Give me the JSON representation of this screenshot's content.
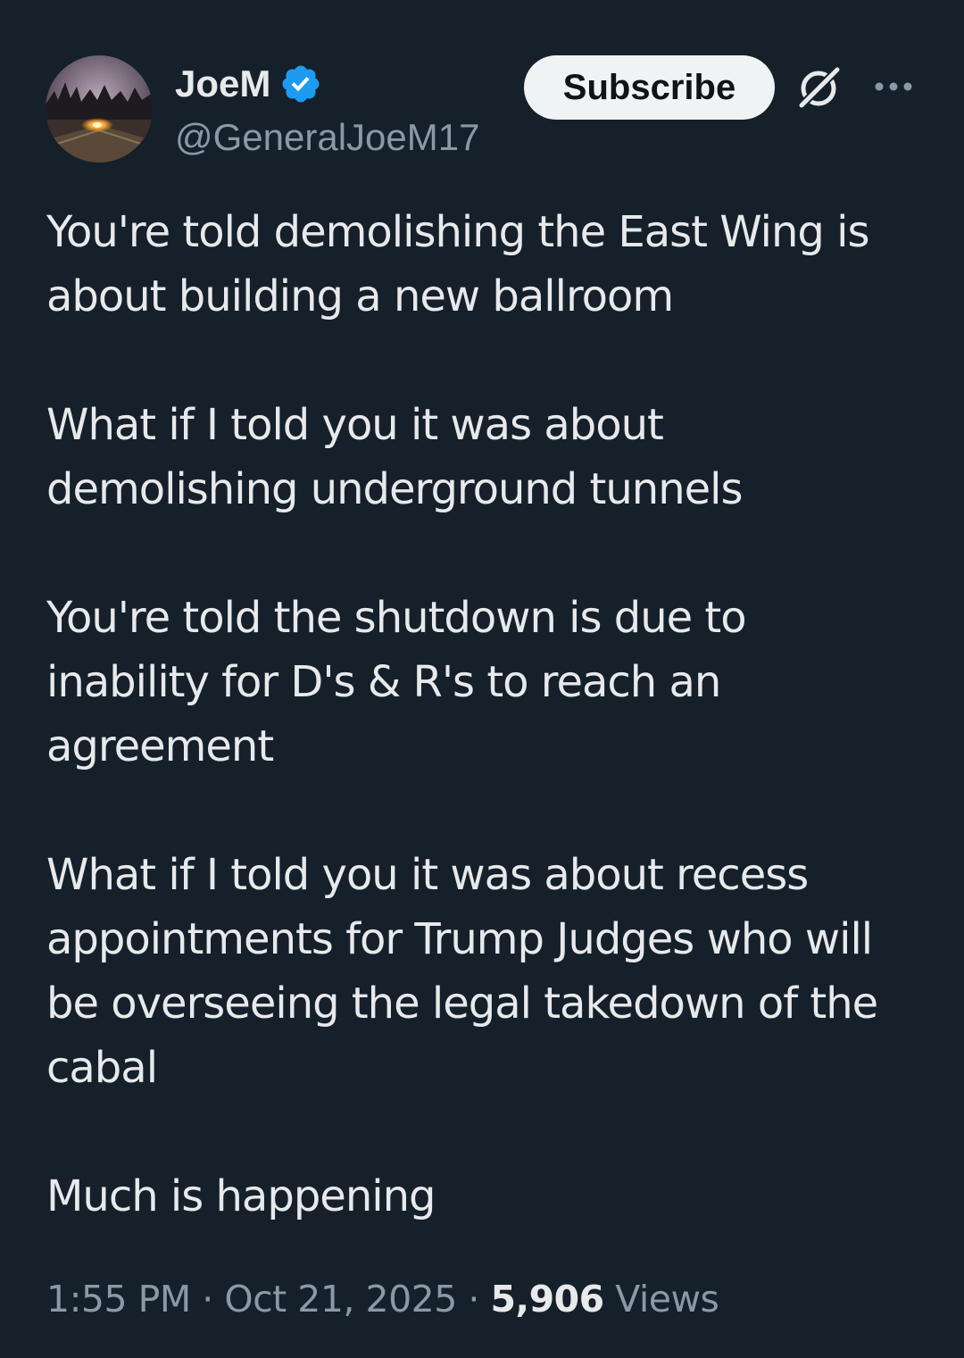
{
  "author": {
    "display_name": "JoeM",
    "handle": "@GeneralJoeM17",
    "verified": true,
    "avatar_icon": "avatar-photo"
  },
  "actions": {
    "subscribe_label": "Subscribe",
    "grok_icon": "grok-icon",
    "more_icon": "more-icon"
  },
  "tweet": {
    "paragraphs": [
      "You're told demolishing the East Wing is about building a new ballroom",
      "What if I told you it was about demolishing underground tunnels",
      "You're told the shutdown is due to inability for D's & R's to reach an agreement",
      "What if I told you it was about recess appointments for Trump Judges who will be overseeing the legal takedown of the cabal",
      "Much is happening"
    ]
  },
  "meta": {
    "time": "1:55 PM",
    "separator": "·",
    "date": "Oct 21, 2025",
    "views_count": "5,906",
    "views_label": "Views"
  },
  "colors": {
    "background": "#15202b",
    "text_primary": "#e7e9ea",
    "text_secondary": "#8b98a5",
    "verified_blue": "#1d9bf0",
    "button_bg": "#eff3f4"
  }
}
